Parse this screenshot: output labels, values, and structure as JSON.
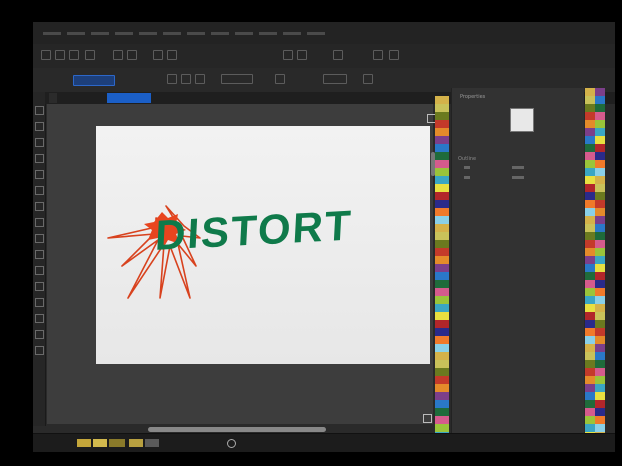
{
  "artwork": {
    "distorted_text": "DISTORT",
    "text_color": "#0f7a4a",
    "burst_color": "#e8451f"
  },
  "menus": [
    "File",
    "Edit",
    "View",
    "Layout",
    "Object",
    "Effects",
    "Bitmaps",
    "Text",
    "Table",
    "Tools",
    "Window",
    "Help"
  ],
  "docker": {
    "title": "Properties",
    "labels": [
      "Outline",
      "",
      ""
    ]
  },
  "document_tab": "Untitled-1",
  "status": {
    "zoom": ""
  },
  "palette_colors": [
    "#d4b24a",
    "#c9c25a",
    "#6b7a1f",
    "#c43a2a",
    "#e48b2a",
    "#7c3f8a",
    "#2a78c8",
    "#1f6b3b",
    "#d55b8d",
    "#9ac43a",
    "#3aa6c4",
    "#e8e041",
    "#b2262a",
    "#2a2a8a",
    "#f07a2a",
    "#8ad0e8"
  ]
}
